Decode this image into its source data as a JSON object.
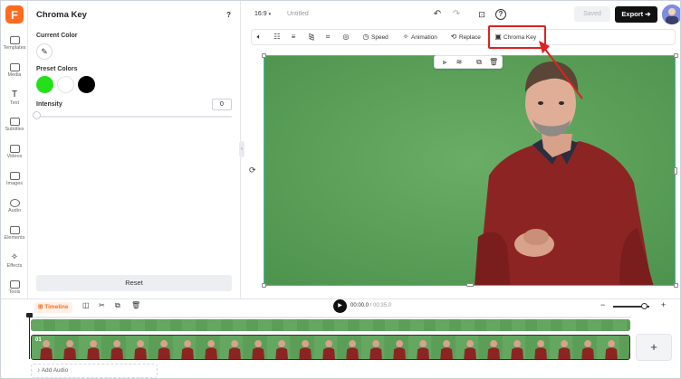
{
  "rail": {
    "items": [
      {
        "label": "Templates",
        "icon": "templates-icon"
      },
      {
        "label": "Media",
        "icon": "media-icon"
      },
      {
        "label": "Text",
        "icon": "text-icon"
      },
      {
        "label": "Subtitles",
        "icon": "subtitles-icon"
      },
      {
        "label": "Videos",
        "icon": "videos-icon"
      },
      {
        "label": "Images",
        "icon": "images-icon"
      },
      {
        "label": "Audio",
        "icon": "audio-icon"
      },
      {
        "label": "Elements",
        "icon": "elements-icon"
      },
      {
        "label": "Effects",
        "icon": "effects-icon"
      },
      {
        "label": "Tools",
        "icon": "tools-icon"
      }
    ]
  },
  "panel": {
    "title": "Chroma Key",
    "help": "?",
    "current_color_label": "Current Color",
    "preset_colors_label": "Preset Colors",
    "preset_colors": [
      "#22e11a",
      "#ffffff",
      "#000000"
    ],
    "intensity_label": "Intensity",
    "intensity_value": "0",
    "intensity_fraction": 0,
    "reset_label": "Reset"
  },
  "topbar": {
    "ratio": "16:9",
    "title": "Untitled",
    "saved_label": "Saved",
    "export_label": "Export"
  },
  "toolbar": {
    "speed": "Speed",
    "animation": "Animation",
    "replace": "Replace",
    "chroma_key": "Chroma Key"
  },
  "timeline": {
    "timeline_label": "Timeline",
    "current_time": "00:00.0",
    "total_time": "/ 00:35.0",
    "clip_label": "01",
    "add_audio_label": "Add Audio",
    "zoom_fraction": 0.85
  },
  "colors": {
    "accent": "#ff6a1f",
    "annotation": "#e02020",
    "selection": "#38bdb5",
    "green_screen": "#5fa35e"
  }
}
